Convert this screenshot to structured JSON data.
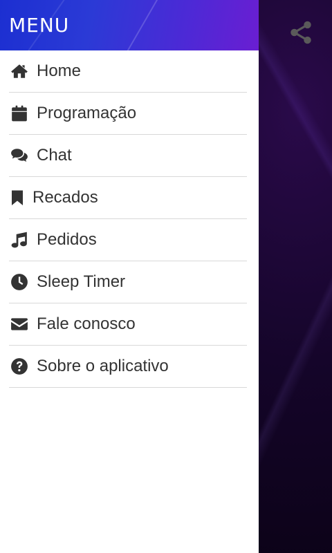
{
  "drawer": {
    "title": "MENU",
    "items": [
      {
        "label": "Home",
        "icon": "home-icon"
      },
      {
        "label": "Programação",
        "icon": "calendar-icon"
      },
      {
        "label": "Chat",
        "icon": "chat-icon"
      },
      {
        "label": "Recados",
        "icon": "bookmark-icon"
      },
      {
        "label": "Pedidos",
        "icon": "music-note-icon"
      },
      {
        "label": "Sleep Timer",
        "icon": "clock-icon"
      },
      {
        "label": "Fale conosco",
        "icon": "envelope-icon"
      },
      {
        "label": "Sobre o aplicativo",
        "icon": "question-circle-icon"
      }
    ]
  },
  "app": {
    "share_icon": "share-icon"
  },
  "colors": {
    "header_start": "#1c2fd1",
    "header_end": "#6a1ed2",
    "text": "#333333",
    "background": "#0d0318"
  }
}
